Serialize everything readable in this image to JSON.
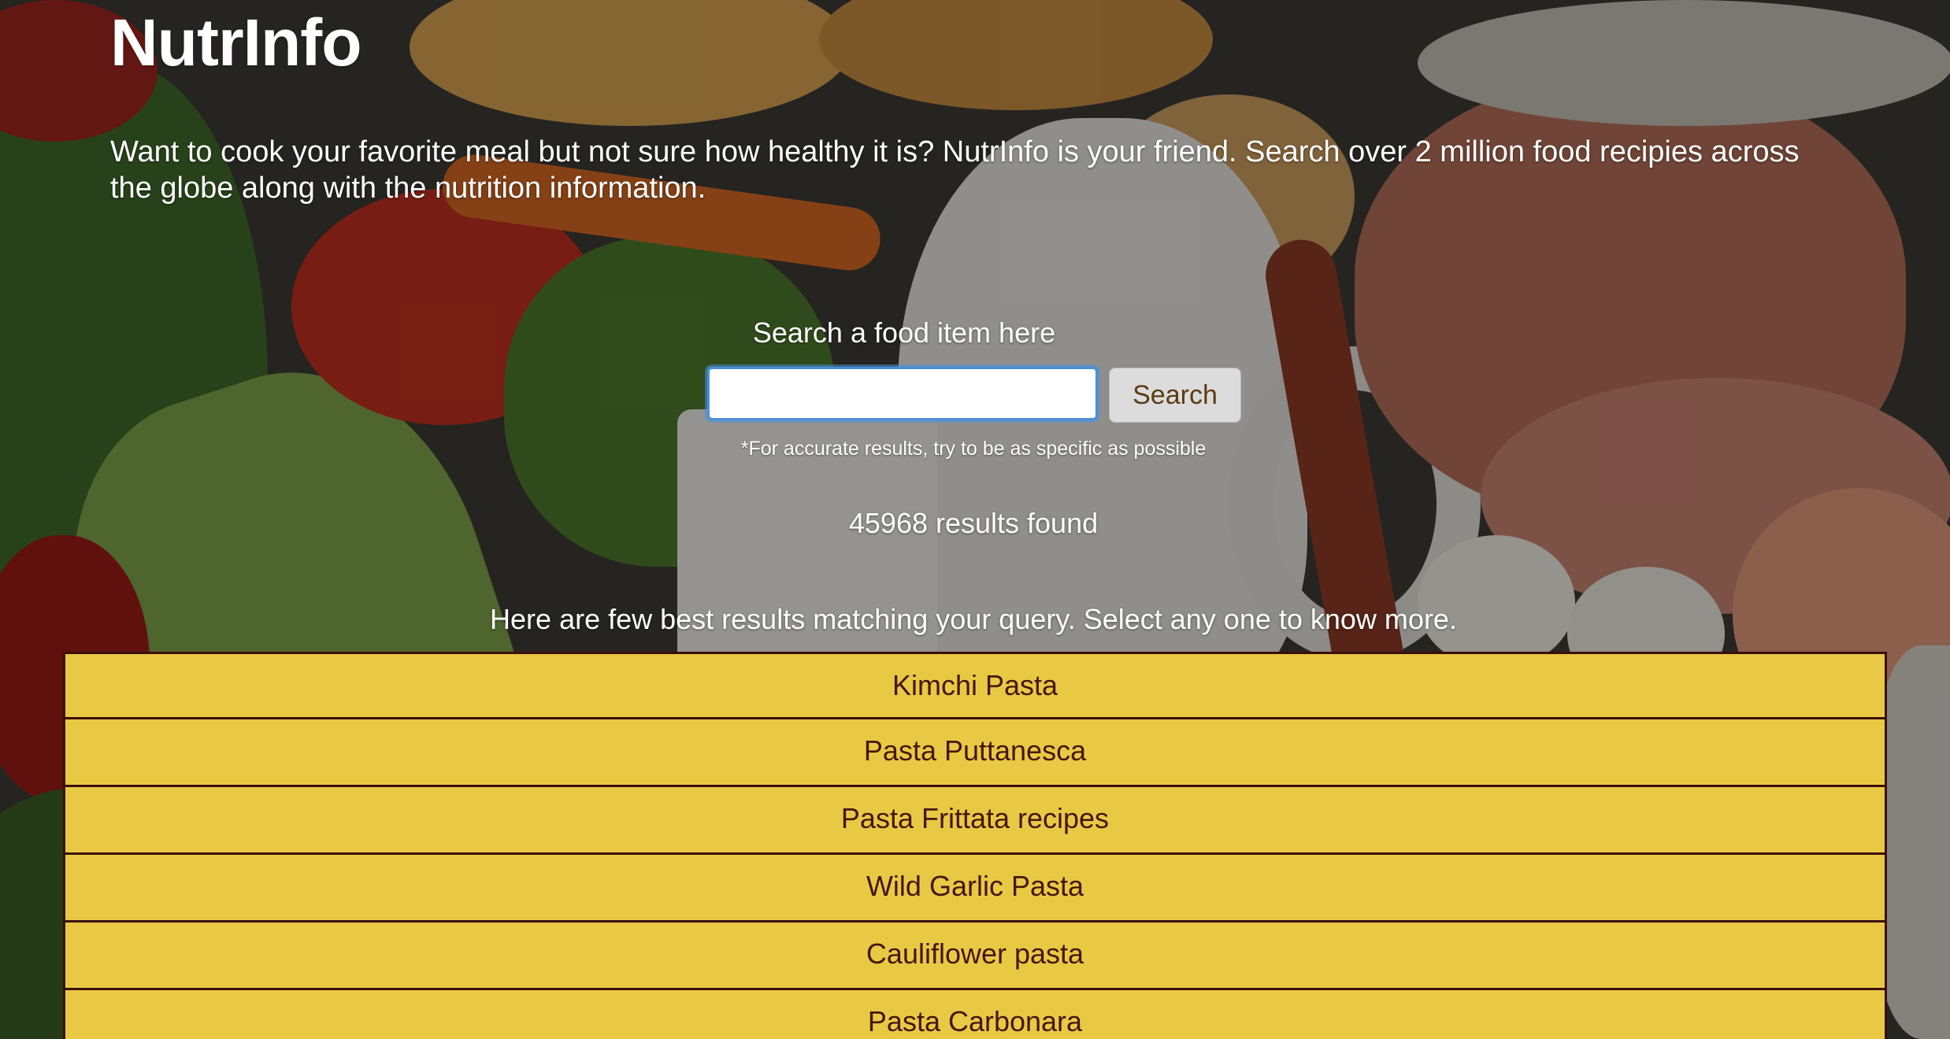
{
  "app": {
    "title": "NutrInfo",
    "intro": "Want to cook your favorite meal but not sure how healthy it is? NutrInfo is your friend. Search over 2 million food recipies across the globe along with the nutrition information."
  },
  "search": {
    "label": "Search a food item here",
    "value": "",
    "button_label": "Search",
    "hint": "*For accurate results, try to be as specific as possible"
  },
  "results": {
    "count_text": "45968 results found",
    "prompt": "Here are few best results matching your query. Select any one to know more.",
    "items": [
      {
        "label": "Kimchi Pasta"
      },
      {
        "label": "Pasta Puttanesca"
      },
      {
        "label": "Pasta Frittata recipes"
      },
      {
        "label": "Wild Garlic Pasta"
      },
      {
        "label": "Cauliflower pasta"
      },
      {
        "label": "Pasta Carbonara"
      }
    ]
  },
  "colors": {
    "result_background": "#e9c944",
    "result_border": "#3a0f08",
    "result_text": "#4a1408",
    "focus_ring": "#4a90d9"
  }
}
